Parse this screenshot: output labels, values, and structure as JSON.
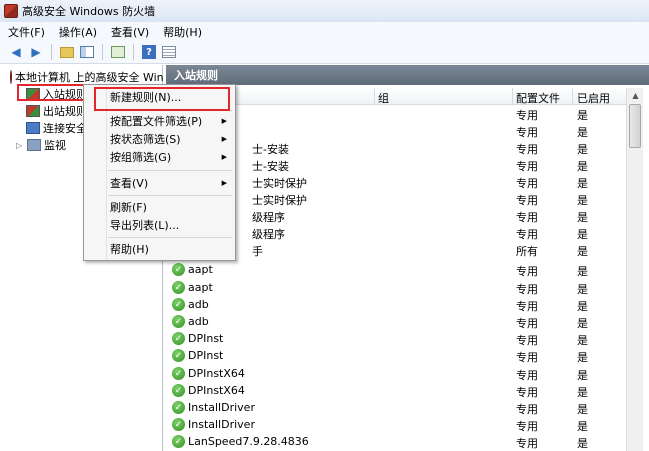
{
  "window": {
    "title": "高级安全 Windows 防火墙"
  },
  "menubar": [
    "文件(F)",
    "操作(A)",
    "查看(V)",
    "帮助(H)"
  ],
  "tree": {
    "root": "本地计算机 上的高级安全 Windows",
    "items": [
      "入站规则",
      "出站规则",
      "连接安全",
      "监视"
    ]
  },
  "panel": {
    "title": "入站规则"
  },
  "columns": {
    "group": "组",
    "profile": "配置文件",
    "enabled": "已启用"
  },
  "rows": [
    {
      "name": "",
      "profile": "专用",
      "enabled": "是"
    },
    {
      "name": "",
      "profile": "专用",
      "enabled": "是"
    },
    {
      "name": "士-安装",
      "profile": "专用",
      "enabled": "是"
    },
    {
      "name": "士-安装",
      "profile": "专用",
      "enabled": "是"
    },
    {
      "name": "士实时保护",
      "profile": "专用",
      "enabled": "是"
    },
    {
      "name": "士实时保护",
      "profile": "专用",
      "enabled": "是"
    },
    {
      "name": "级程序",
      "profile": "专用",
      "enabled": "是"
    },
    {
      "name": "级程序",
      "profile": "专用",
      "enabled": "是"
    },
    {
      "name": "手",
      "profile": "所有",
      "enabled": "是"
    },
    {
      "name": "aapt",
      "profile": "专用",
      "enabled": "是"
    },
    {
      "name": "aapt",
      "profile": "专用",
      "enabled": "是"
    },
    {
      "name": "adb",
      "profile": "专用",
      "enabled": "是"
    },
    {
      "name": "adb",
      "profile": "专用",
      "enabled": "是"
    },
    {
      "name": "DPInst",
      "profile": "专用",
      "enabled": "是"
    },
    {
      "name": "DPInst",
      "profile": "专用",
      "enabled": "是"
    },
    {
      "name": "DPInstX64",
      "profile": "专用",
      "enabled": "是"
    },
    {
      "name": "DPInstX64",
      "profile": "专用",
      "enabled": "是"
    },
    {
      "name": "InstallDriver",
      "profile": "专用",
      "enabled": "是"
    },
    {
      "name": "InstallDriver",
      "profile": "专用",
      "enabled": "是"
    },
    {
      "name": "LanSpeed7.9.28.4836",
      "profile": "专用",
      "enabled": "是"
    }
  ],
  "context_menu": {
    "new_rule": "新建规则(N)...",
    "filter_profile": "按配置文件筛选(P)",
    "filter_state": "按状态筛选(S)",
    "filter_group": "按组筛选(G)",
    "view": "查看(V)",
    "refresh": "刷新(F)",
    "export": "导出列表(L)...",
    "help": "帮助(H)"
  }
}
